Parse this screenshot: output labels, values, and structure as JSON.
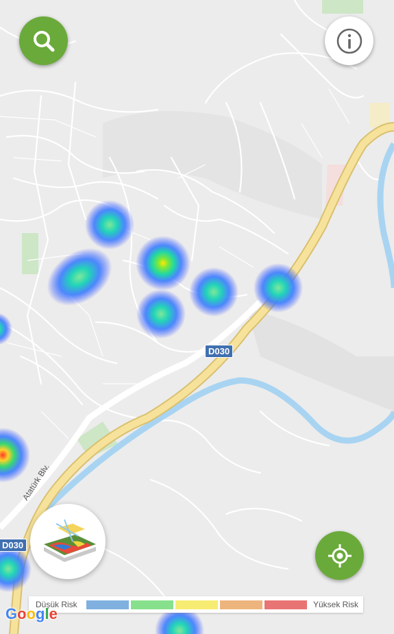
{
  "map": {
    "road_shield_1": "D030",
    "road_shield_2": "D030",
    "street_label": "Atatürk Blv."
  },
  "controls": {
    "search_icon": "search-icon",
    "info_icon": "info-icon",
    "locate_icon": "crosshair-icon",
    "layer_icon": "heatmap-layer-icon"
  },
  "legend": {
    "low_label": "Düşük Risk",
    "high_label": "Yüksek Risk",
    "colors": [
      "#7fb0e0",
      "#86e08c",
      "#f6ec72",
      "#eeb47d",
      "#e87474"
    ]
  },
  "attribution": {
    "google": [
      "G",
      "o",
      "o",
      "g",
      "l",
      "e"
    ],
    "google_colors": [
      "#4285f4",
      "#ea4335",
      "#fbbc05",
      "#4285f4",
      "#34a853",
      "#ea4335"
    ]
  },
  "theme": {
    "accent": "#6aaa3a",
    "river": "#a8d4f2",
    "highway": "#f5d97a"
  }
}
